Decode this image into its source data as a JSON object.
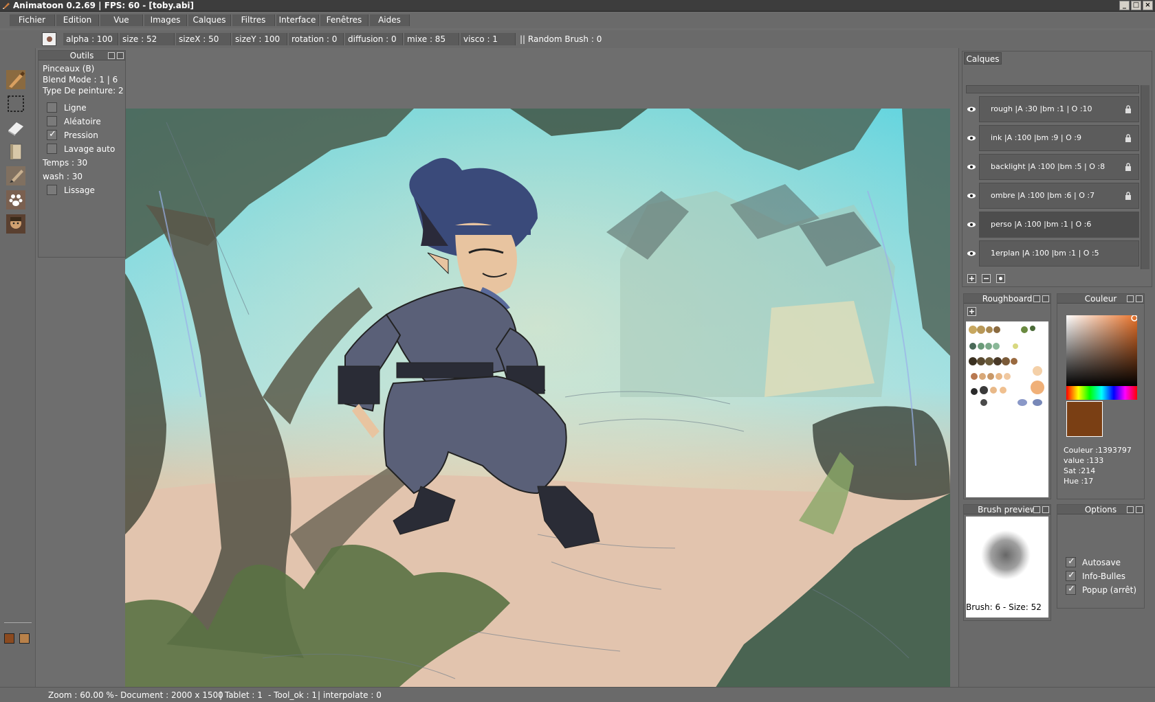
{
  "window": {
    "title": "Animatoon 0.2.69  |  FPS: 60  - [toby.abi]",
    "minimize": "_",
    "maximize": "□",
    "close": "×"
  },
  "menu": [
    "Fichier",
    "Edition",
    "Vue",
    "Images",
    "Calques",
    "Filtres",
    "Interface",
    "Fenêtres",
    "Aides"
  ],
  "params": {
    "alpha": "alpha : 100",
    "size": "size : 52",
    "sizeX": "sizeX : 50",
    "sizeY": "sizeY : 100",
    "rotation": "rotation : 0",
    "diffusion": "diffusion : 0",
    "mixe": "mixe : 85",
    "visco": "visco : 1",
    "random": "||  Random Brush : 0"
  },
  "tools": [
    "brush-icon",
    "selection-icon",
    "eraser-icon",
    "paper-icon",
    "pencil-icon",
    "paw-icon",
    "character-icon"
  ],
  "colors": {
    "primary": "#8b4a1f",
    "secondary": "#b8814a",
    "current": "#7a3f14",
    "accent_hue": "#e8722a"
  },
  "outils": {
    "title": "Outils",
    "tool_name": "Pinceaux (B)",
    "blend_mode": "Blend Mode : 1 | 6",
    "paint_type": "Type De peinture: 2",
    "options": [
      {
        "label": "Ligne",
        "checked": false
      },
      {
        "label": "Aléatoire",
        "checked": false
      },
      {
        "label": "Pression",
        "checked": true
      },
      {
        "label": "Lavage auto",
        "checked": false
      }
    ],
    "temps": "Temps : 30",
    "wash": "wash : 30",
    "lissage": {
      "label": "Lissage",
      "checked": false
    }
  },
  "calques": {
    "tab": "Calques",
    "layers": [
      {
        "label": "rough  |A :30  |bm :1  | O :10",
        "locked": true,
        "selected": false
      },
      {
        "label": "ink  |A :100  |bm :9  | O :9",
        "locked": true,
        "selected": false
      },
      {
        "label": "backlight  |A :100  |bm :5  | O :8",
        "locked": true,
        "selected": false
      },
      {
        "label": "ombre  |A :100  |bm :6  | O :7",
        "locked": true,
        "selected": false
      },
      {
        "label": "perso  |A :100  |bm :1  | O :6",
        "locked": false,
        "selected": true
      },
      {
        "label": "1erplan  |A :100  |bm :1  | O :5",
        "locked": false,
        "selected": false
      }
    ]
  },
  "roughboard": {
    "title": "Roughboard"
  },
  "couleur": {
    "title": "Couleur",
    "couleur": "Couleur :1393797",
    "value": "value :133",
    "sat": "Sat :214",
    "hue": "Hue :17"
  },
  "brush_preview": {
    "title": "Brush preview",
    "caption": "Brush: 6 - Size: 52"
  },
  "options": {
    "title": "Options",
    "items": [
      {
        "label": "Autosave",
        "checked": true
      },
      {
        "label": "Info-Bulles",
        "checked": true
      },
      {
        "label": "Popup (arrêt)",
        "checked": true
      }
    ]
  },
  "status": {
    "zoom": "Zoom : 60.00 %",
    "document": "-  Document : 2000 x 1500",
    "tablet": "|  Tablet : 1",
    "tool_ok": "-  Tool_ok : 1",
    "interpolate": "| interpolate : 0"
  }
}
